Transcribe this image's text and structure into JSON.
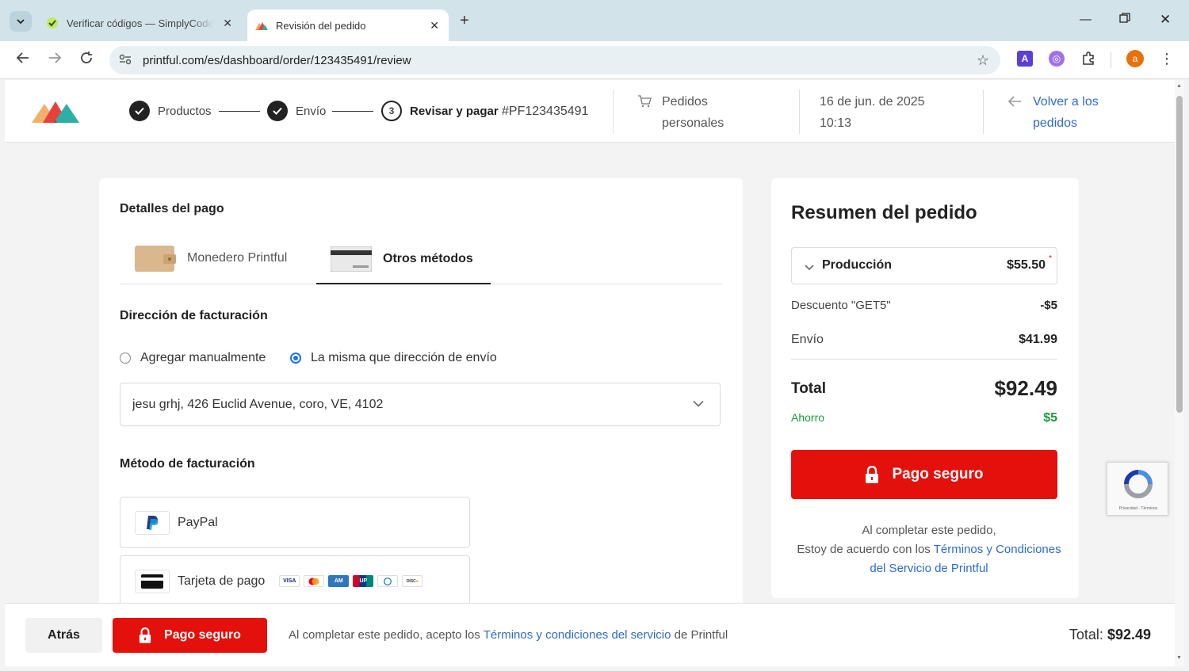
{
  "browser": {
    "tabs": [
      {
        "title": "Verificar códigos — SimplyCodes",
        "active": false
      },
      {
        "title": "Revisión del pedido",
        "active": true
      }
    ],
    "url": "printful.com/es/dashboard/order/123435491/review",
    "profile_initial": "a",
    "extension_letter": "A"
  },
  "header": {
    "steps": [
      {
        "label": "Productos",
        "done": true
      },
      {
        "label": "Envío",
        "done": true
      },
      {
        "label": "Revisar y pagar",
        "number": "3",
        "current": true
      }
    ],
    "order_number": "#PF123435491",
    "order_type_line1": "Pedidos",
    "order_type_line2": "personales",
    "date_line1": "16 de jun. de 2025",
    "date_line2": "10:13",
    "back_link_line1": "Volver a los",
    "back_link_line2": "pedidos"
  },
  "payment": {
    "heading": "Detalles del pago",
    "tabs": [
      {
        "label": "Monedero Printful",
        "active": false
      },
      {
        "label": "Otros métodos",
        "active": true
      }
    ],
    "billing_address_heading": "Dirección de facturación",
    "radio_manual": "Agregar manualmente",
    "radio_same": "La misma que dirección de envío",
    "selected_address": "jesu grhj, 426 Euclid Avenue, coro, VE, 4102",
    "billing_method_heading": "Método de facturación",
    "methods": [
      {
        "label": "PayPal",
        "icon": "paypal-icon"
      },
      {
        "label": "Tarjeta de pago",
        "icon": "credit-card-icon",
        "brands": [
          "VISA",
          "Mastercard",
          "Amex",
          "UnionPay",
          "Diners",
          "Discover"
        ]
      }
    ]
  },
  "summary": {
    "title": "Resumen del pedido",
    "production_label": "Producción",
    "production_value": "$55.50",
    "asterisk": "*",
    "discount_label": "Descuento \"GET5\"",
    "discount_value": "-$5",
    "shipping_label": "Envío",
    "shipping_value": "$41.99",
    "total_label": "Total",
    "total_value": "$92.49",
    "savings_label": "Ahorro",
    "savings_value": "$5",
    "pay_button": "Pago seguro",
    "terms_line1": "Al completar este pedido,",
    "terms_line2": "Estoy de acuerdo con los",
    "terms_link": "Términos y Condiciones del Servicio de Printful"
  },
  "recaptcha": {
    "text": "Privacidad - Términos"
  },
  "bottom_bar": {
    "back_button": "Atrás",
    "pay_button": "Pago seguro",
    "terms_prefix": "Al completar este pedido, acepto los",
    "terms_link": "Términos y condiciones del servicio",
    "terms_suffix": "de Printful",
    "total_label": "Total:",
    "total_value": "$92.49"
  },
  "colors": {
    "accent_red": "#e4100b",
    "link_blue": "#2d6bd0",
    "savings_green": "#1a9b3a"
  }
}
